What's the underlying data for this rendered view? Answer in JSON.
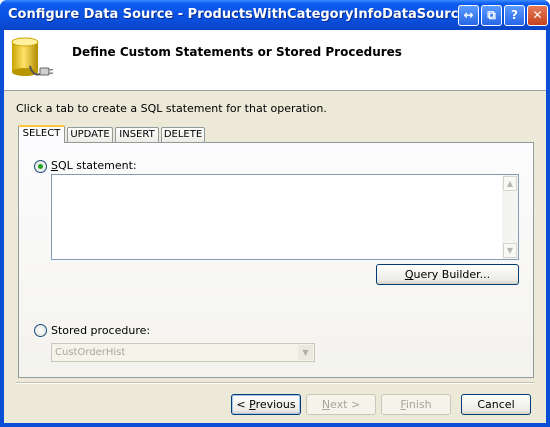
{
  "window": {
    "title": "Configure Data Source - ProductsWithCategoryInfoDataSource",
    "controls": {
      "back_forward": "↔",
      "restore": "⧉",
      "help": "?",
      "close": "✕"
    }
  },
  "header": {
    "title": "Define Custom Statements or Stored Procedures",
    "icon": "database-connector-icon"
  },
  "instruction": "Click a tab to create a SQL statement for that operation.",
  "tabs": [
    {
      "label": "SELECT",
      "active": true
    },
    {
      "label": "UPDATE",
      "active": false
    },
    {
      "label": "INSERT",
      "active": false
    },
    {
      "label": "DELETE",
      "active": false
    }
  ],
  "panel": {
    "sql_statement": {
      "label_mnemonic": "S",
      "label_rest": "QL statement:",
      "selected": true,
      "value": ""
    },
    "query_builder": {
      "mnemonic": "Q",
      "rest": "uery Builder..."
    },
    "stored_procedure": {
      "label": "Stored procedure:",
      "selected": false
    },
    "procedure_select": {
      "value": "CustOrderHist",
      "enabled": false
    }
  },
  "footer": {
    "previous": {
      "mnemonic": "P",
      "pre": "< ",
      "rest": "revious",
      "enabled": true
    },
    "next": {
      "mnemonic": "N",
      "rest": "ext >",
      "enabled": false
    },
    "finish": {
      "mnemonic": "F",
      "rest": "inish",
      "enabled": false
    },
    "cancel": {
      "label": "Cancel",
      "enabled": true
    }
  },
  "colors": {
    "titlebar": "#0a52e2",
    "dialog": "#ece9d8",
    "radio_dot": "#21a121",
    "active_tab_accent": "#ffc83c"
  }
}
